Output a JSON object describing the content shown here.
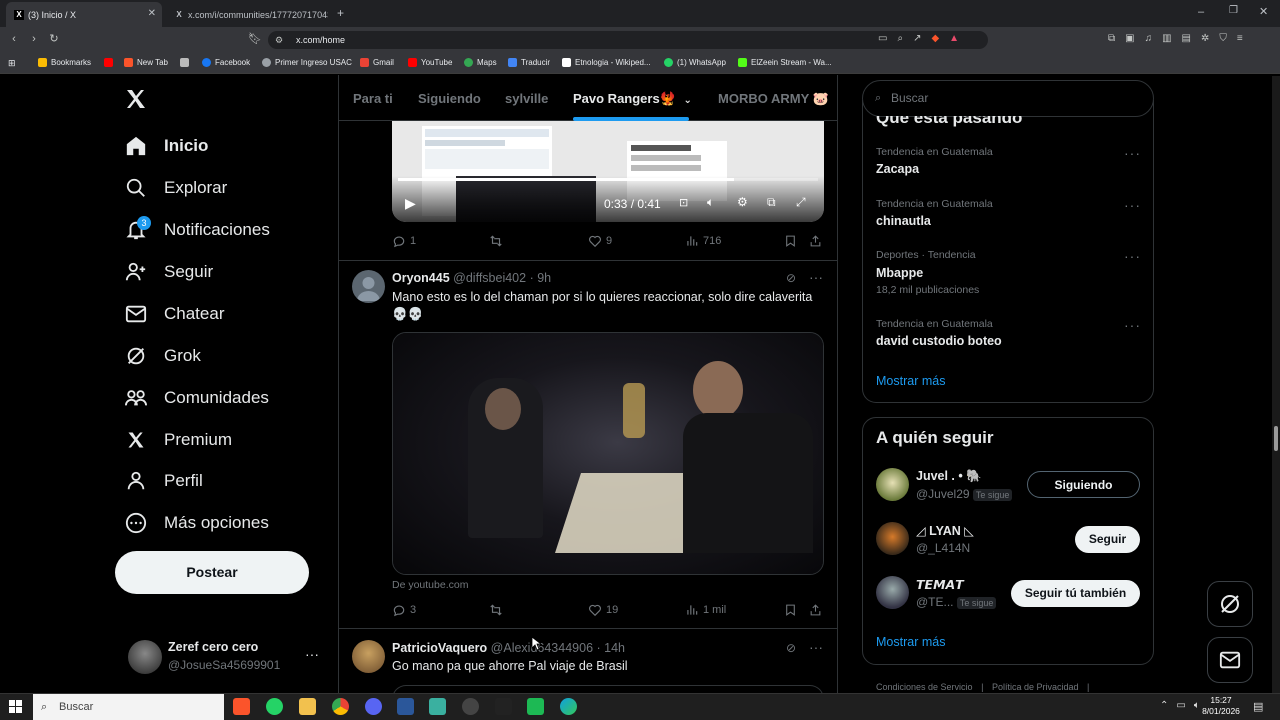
{
  "browser": {
    "tabs": [
      {
        "title": "(3) Inicio / X",
        "active": true
      },
      {
        "title": "x.com/i/communities/177720717043...",
        "active": false
      }
    ],
    "url": "x.com/home",
    "bookmarks": [
      "Bookmarks",
      "New Tab",
      "Gmail",
      "Facebook",
      "Primer Ingreso USAC",
      "Gmail",
      "YouTube",
      "Maps",
      "Traducir",
      "Etnologia - Wikiped...",
      "(1) WhatsApp",
      "ElZeein Stream - Wa..."
    ]
  },
  "nav": {
    "items": [
      {
        "label": "Inicio",
        "icon": "home-icon"
      },
      {
        "label": "Explorar",
        "icon": "search-icon"
      },
      {
        "label": "Notificaciones",
        "icon": "bell-icon",
        "badge": "3"
      },
      {
        "label": "Seguir",
        "icon": "person-plus-icon"
      },
      {
        "label": "Chatear",
        "icon": "mail-icon"
      },
      {
        "label": "Grok",
        "icon": "grok-icon"
      },
      {
        "label": "Comunidades",
        "icon": "people-icon"
      },
      {
        "label": "Premium",
        "icon": "x-logo-icon"
      },
      {
        "label": "Perfil",
        "icon": "person-icon"
      },
      {
        "label": "Más opciones",
        "icon": "more-circle-icon"
      }
    ],
    "post_label": "Postear",
    "account": {
      "name": "Zeref cero cero",
      "handle": "@JosueSa45699901"
    }
  },
  "community_tabs": [
    "Para ti",
    "Siguiendo",
    "sylville",
    "Pavo Rangers🐦‍🔥",
    "MORBO ARMY 🐷"
  ],
  "video_player": {
    "time": "0:33 / 0:41"
  },
  "tweets": [
    {
      "replies": "1",
      "reposts": "",
      "likes": "9",
      "views": "716"
    },
    {
      "name": "Oryon445",
      "handle": "@diffsbei402",
      "time": "· 9h",
      "text": "Mano esto es lo del chaman por si lo quieres reaccionar, solo dire calaverita 💀💀",
      "source": "De youtube.com",
      "replies": "3",
      "reposts": "",
      "likes": "19",
      "views": "1 mil"
    },
    {
      "name": "PatricioVaquero",
      "handle": "@Alexid64344906",
      "time": "· 14h",
      "text": "Go mano pa que ahorre Pal viaje de Brasil"
    }
  ],
  "right": {
    "search_placeholder": "Buscar",
    "trends_heading": "Qué está pasando",
    "trends": [
      {
        "context": "Tendencia en Guatemala",
        "name": "Zacapa",
        "count": ""
      },
      {
        "context": "Tendencia en Guatemala",
        "name": "chinautla",
        "count": ""
      },
      {
        "context": "Deportes · Tendencia",
        "name": "Mbappe",
        "count": "18,2 mil publicaciones"
      },
      {
        "context": "Tendencia en Guatemala",
        "name": "david custodio boteo",
        "count": ""
      }
    ],
    "show_more": "Mostrar más",
    "who_to_follow": "A quién seguir",
    "suggestions": [
      {
        "name": "Juvel . • 🐘",
        "handle": "@Juvel29",
        "follows_you": "Te sigue",
        "button": "Siguiendo"
      },
      {
        "name": "◿ LYAN ◺",
        "handle": "@_L414N",
        "follows_you": "",
        "button": "Seguir"
      },
      {
        "name": "𝙏𝙀𝙈𝘼𝙏",
        "handle": "@TE...",
        "follows_you": "Te sigue",
        "button": "Seguir tú también"
      }
    ],
    "show_more_2": "Mostrar más",
    "footer": [
      "Condiciones de Servicio",
      "Política de Privacidad"
    ]
  },
  "taskbar": {
    "search_placeholder": "Buscar",
    "time": "15:27",
    "date": "8/01/2026"
  }
}
